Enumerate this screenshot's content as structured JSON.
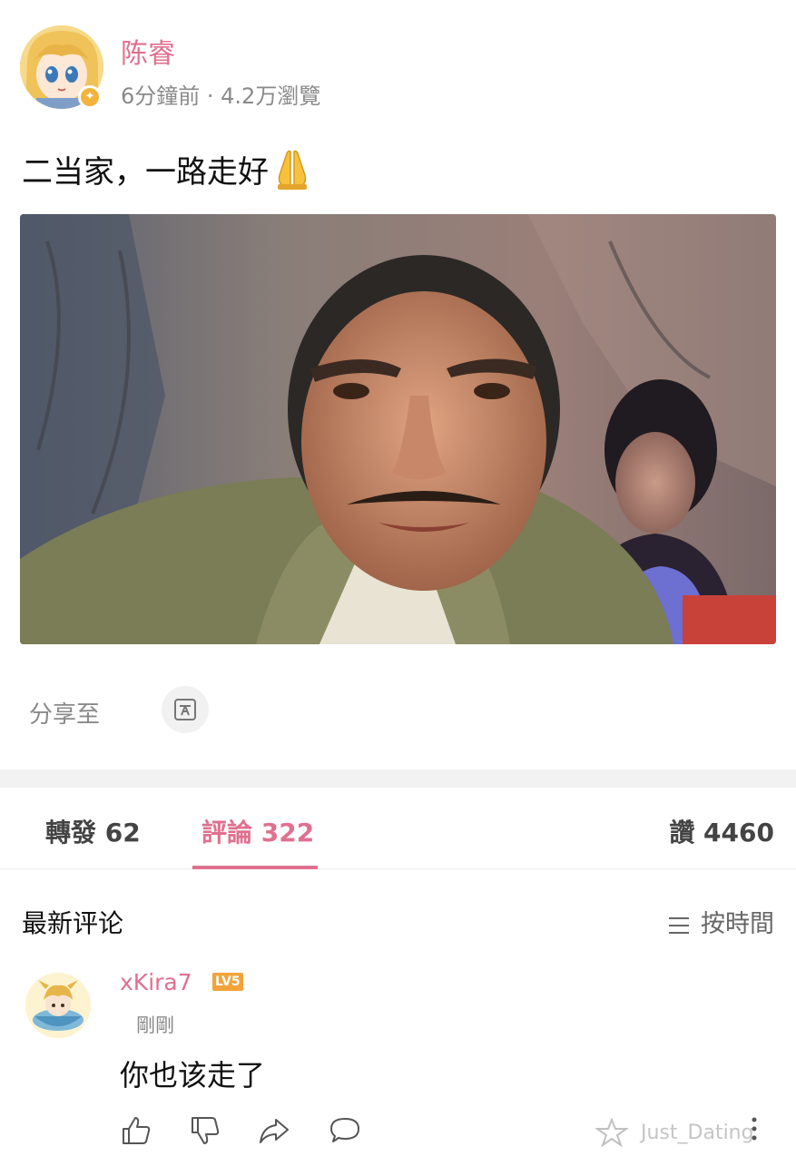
{
  "post": {
    "author": "陈睿",
    "meta": "6分鐘前 · 4.2万瀏覽",
    "text": "二当家，一路走好",
    "share_label": "分享至"
  },
  "tabs": {
    "repost": "轉發 62",
    "comments": "評論 322",
    "likes": "讚 4460"
  },
  "comments_section": {
    "title": "最新评论",
    "sort_label": "按時間"
  },
  "comment": {
    "username": "xKira7",
    "level": "LV5",
    "time": "剛剛",
    "text": "你也该走了"
  },
  "watermark": "Just_Dating",
  "icons": [
    "avatar-image",
    "vip-badge-icon",
    "pray-emoji-icon",
    "share-icon",
    "sort-icon",
    "thumbs-up-icon",
    "thumbs-down-icon",
    "forward-icon",
    "comment-icon",
    "more-icon",
    "watermark-logo-icon"
  ],
  "colors": {
    "accent": "#e0708f",
    "muted": "#8a8a8a",
    "level_badge": "#f2a33a",
    "divider": "#f2f2f2"
  }
}
